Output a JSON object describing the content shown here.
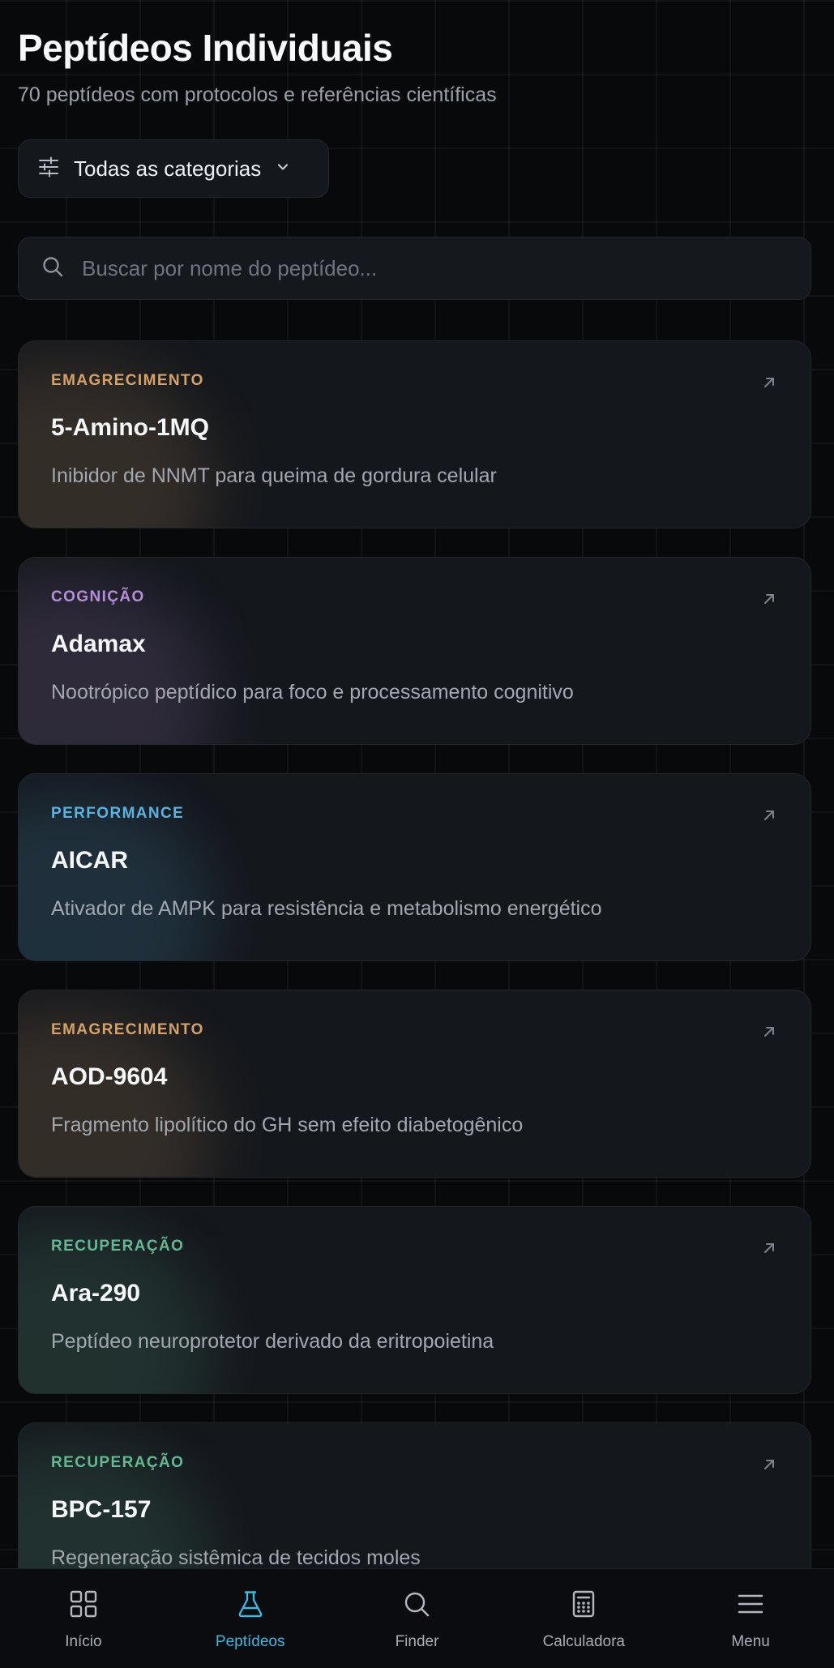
{
  "header": {
    "title": "Peptídeos Individuais",
    "subtitle": "70 peptídeos com protocolos e referências científicas"
  },
  "filter": {
    "label": "Todas as categorias",
    "icon": "sliders-icon",
    "chevron": "chevron-down-icon"
  },
  "search": {
    "placeholder": "Buscar por nome do peptídeo...",
    "value": ""
  },
  "colors": {
    "emagrecimento": "#d4a167",
    "cognicao": "#b68ed8",
    "performance": "#5bb2e0",
    "recuperacao": "#63b892",
    "accent": "#3bb8e0"
  },
  "cards": [
    {
      "category": "EMAGRECIMENTO",
      "color_key": "emagrecimento",
      "name": "5-Amino-1MQ",
      "description": "Inibidor de NNMT para queima de gordura celular"
    },
    {
      "category": "COGNIÇÃO",
      "color_key": "cognicao",
      "name": "Adamax",
      "description": "Nootrópico peptídico para foco e processamento cognitivo"
    },
    {
      "category": "PERFORMANCE",
      "color_key": "performance",
      "name": "AICAR",
      "description": "Ativador de AMPK para resistência e metabolismo energético"
    },
    {
      "category": "EMAGRECIMENTO",
      "color_key": "emagrecimento",
      "name": "AOD-9604",
      "description": "Fragmento lipolítico do GH sem efeito diabetogênico"
    },
    {
      "category": "RECUPERAÇÃO",
      "color_key": "recuperacao",
      "name": "Ara-290",
      "description": "Peptídeo neuroprotetor derivado da eritropoietina"
    },
    {
      "category": "RECUPERAÇÃO",
      "color_key": "recuperacao",
      "name": "BPC-157",
      "description": "Regeneração sistêmica de tecidos moles"
    }
  ],
  "nav": {
    "items": [
      {
        "label": "Início",
        "icon": "grid-icon",
        "active": false
      },
      {
        "label": "Peptídeos",
        "icon": "flask-icon",
        "active": true
      },
      {
        "label": "Finder",
        "icon": "search-icon",
        "active": false
      },
      {
        "label": "Calculadora",
        "icon": "calculator-icon",
        "active": false
      },
      {
        "label": "Menu",
        "icon": "menu-icon",
        "active": false
      }
    ]
  }
}
